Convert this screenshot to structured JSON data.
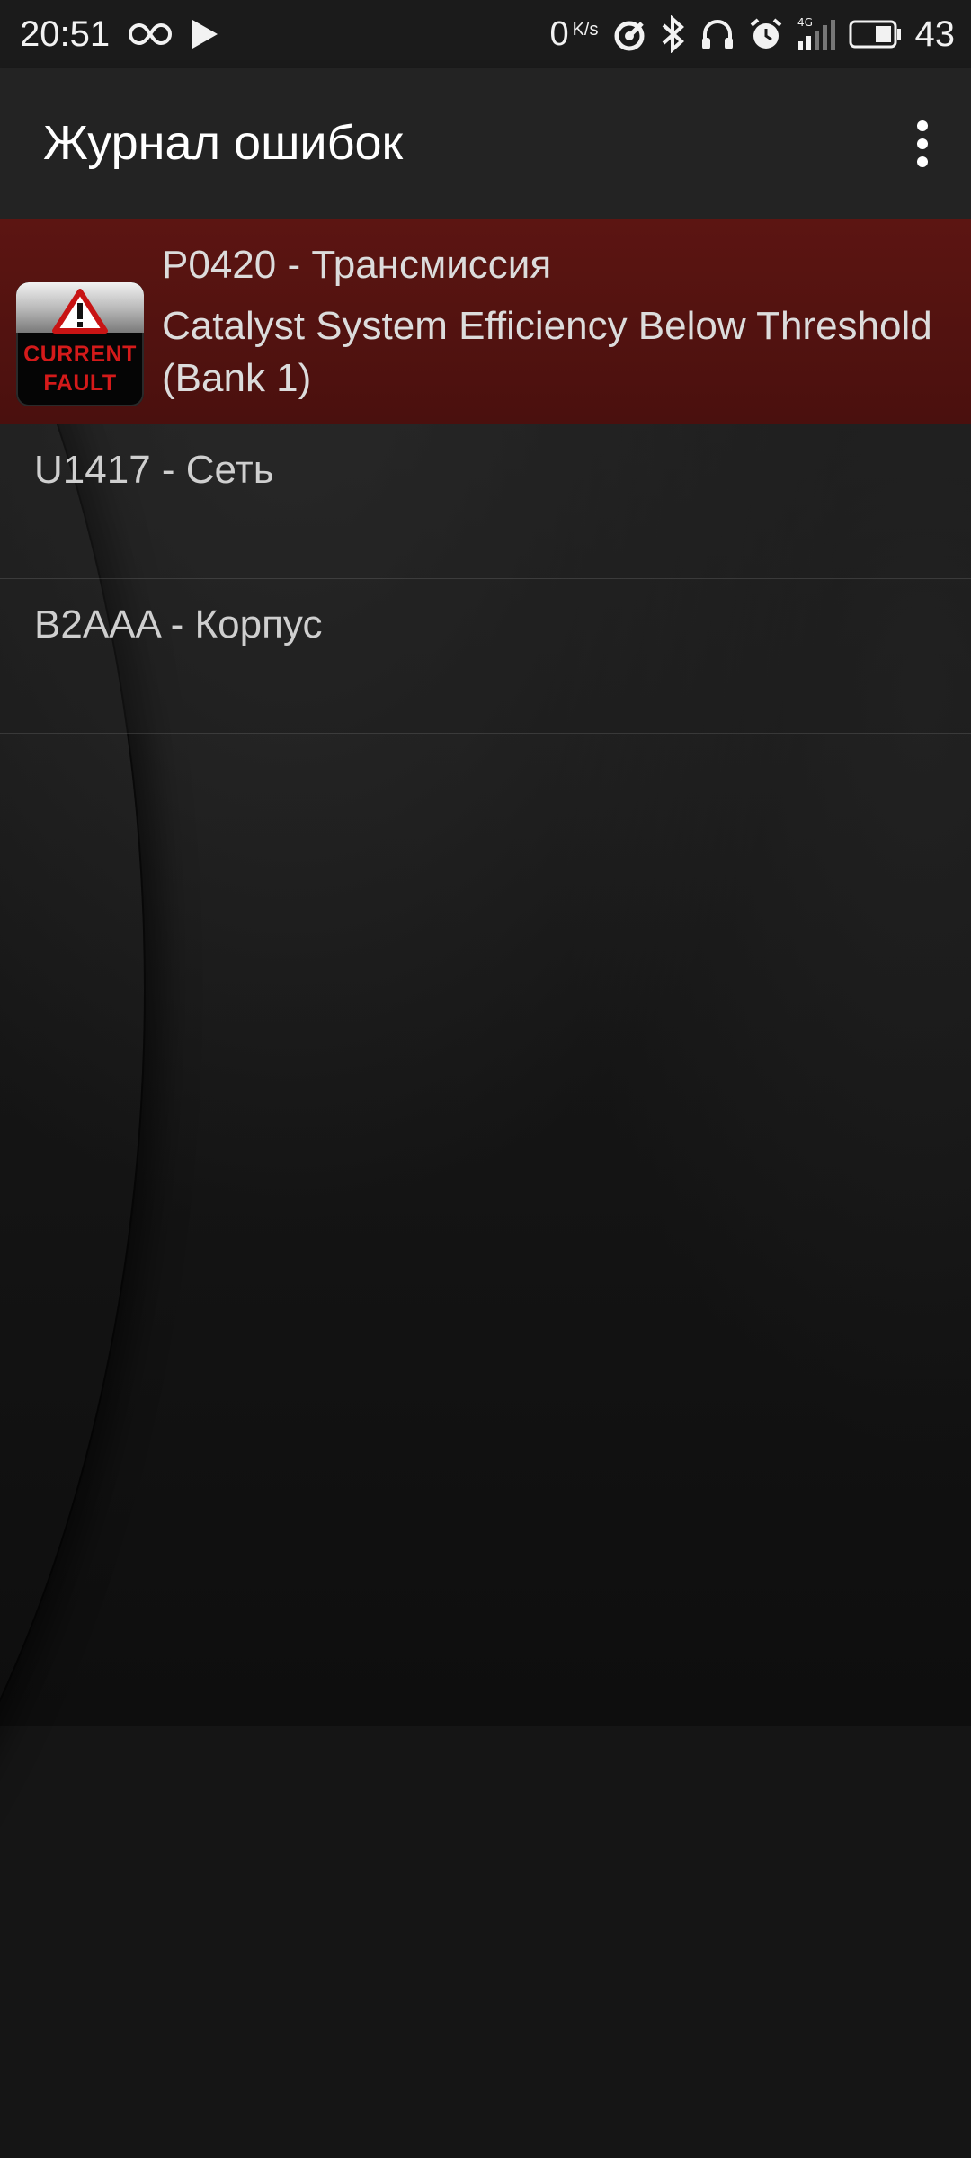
{
  "status_bar": {
    "time": "20:51",
    "speed_value": "0",
    "speed_unit": "K/s",
    "network": "4G",
    "battery": "43",
    "icons": [
      "infinity-icon",
      "play-icon",
      "data-saver-icon",
      "bluetooth-icon",
      "headphones-icon",
      "alarm-icon",
      "signal-icon",
      "battery-icon"
    ]
  },
  "app_bar": {
    "title": "Журнал ошибок",
    "menu_icon": "more-vert-icon"
  },
  "faults": [
    {
      "code": "P0420 - Трансмиссия",
      "description": "Catalyst System Efficiency Below Threshold (Bank 1)",
      "badge_line1": "CURRENT",
      "badge_line2": "FAULT",
      "badge_icon": "warning-icon",
      "highlight_color": "#5c1512"
    },
    {
      "code": "U1417 - Сеть"
    },
    {
      "code": "B2AAA - Корпус"
    }
  ]
}
